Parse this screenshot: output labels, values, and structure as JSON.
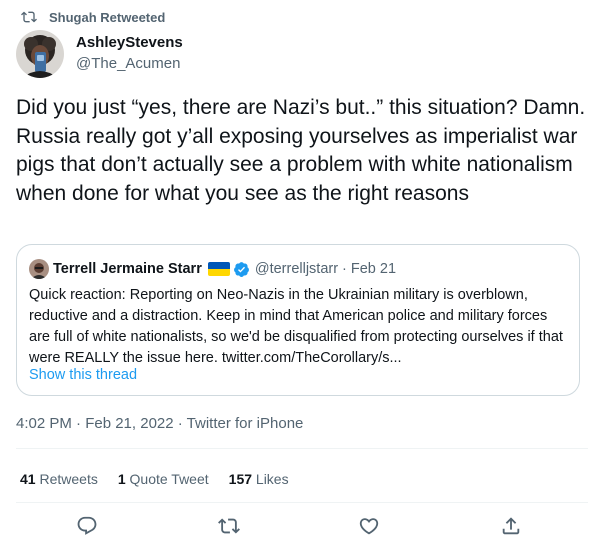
{
  "retweet_banner": {
    "text": "Shugah Retweeted",
    "icon": "retweet-icon"
  },
  "author": {
    "name": "AshleyStevens",
    "handle": "@The_Acumen",
    "avatar": "avatar"
  },
  "tweet": {
    "text": "Did you just “yes, there are Nazi’s but..” this situation? Damn. Russia really got y’all exposing yourselves as imperialist war pigs that don’t actually see a problem with white nationalism when done for what you see as the right reasons"
  },
  "quote": {
    "name": "Terrell Jermaine Starr",
    "flag": "ukraine-flag",
    "verified_icon": "verified-badge-icon",
    "handle": "@terrelljstarr",
    "separator": "·",
    "date": "Feb 21",
    "text": "Quick reaction: Reporting on Neo-Nazis in the Ukrainian military is overblown, reductive and a distraction. Keep in mind that American police and military forces are full of white nationalists, so we'd be disqualified from protecting ourselves if that were REALLY the issue here. twitter.com/TheCorollary/s...",
    "show_thread": "Show this thread"
  },
  "meta": {
    "timestamp": "4:02 PM · Feb 21, 2022 · Twitter for iPhone"
  },
  "stats": {
    "retweets_count": "41",
    "retweets_label": "Retweets",
    "quotes_count": "1",
    "quotes_label": "Quote Tweet",
    "likes_count": "157",
    "likes_label": "Likes"
  },
  "actions": [
    "reply-icon",
    "retweet-icon",
    "like-icon",
    "share-icon"
  ],
  "colors": {
    "accent": "#1d9bf0",
    "text": "#0f1419",
    "secondary": "#536471",
    "border": "#cfd9de",
    "flag_blue": "#0057b7",
    "flag_yellow": "#ffd700"
  }
}
